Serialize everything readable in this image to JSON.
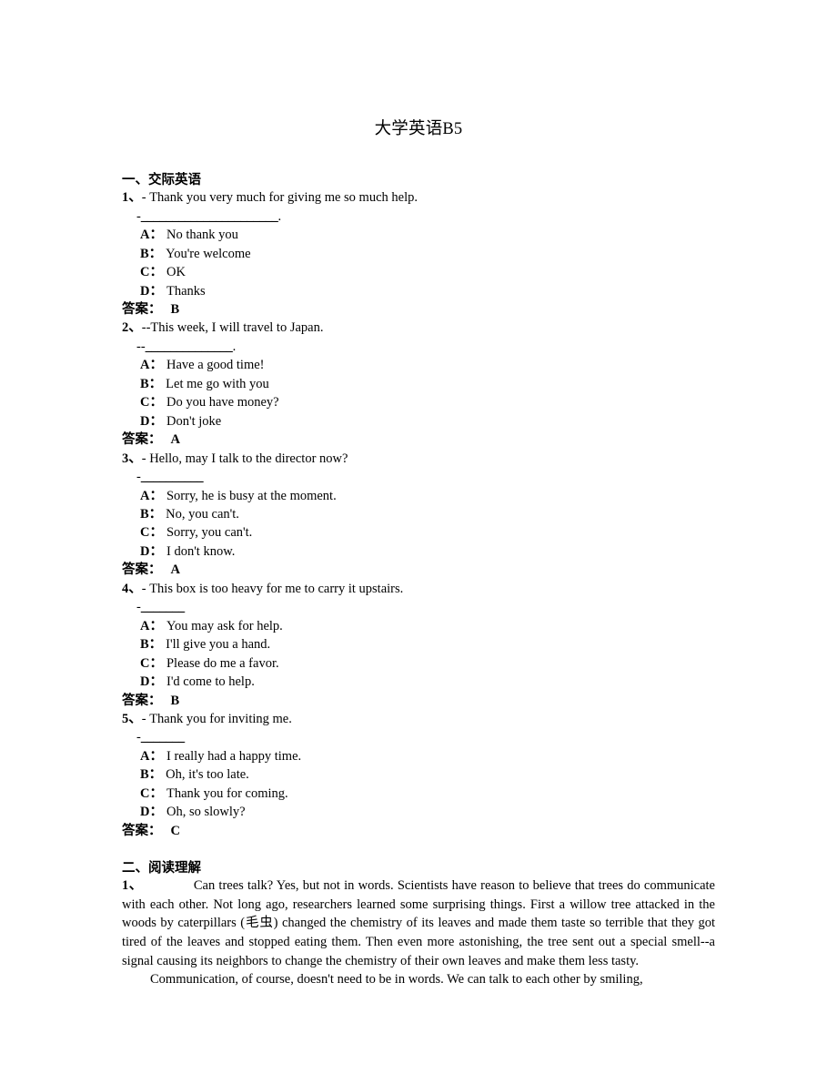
{
  "document": {
    "title": "大学英语B5"
  },
  "sections": [
    {
      "heading": "一、交际英语",
      "questions": [
        {
          "number": "1、",
          "stem": "- Thank you very much for giving me so much help.",
          "blank_prefix": "-",
          "blank": "______________________",
          "blank_suffix": ".",
          "options": [
            {
              "letter": "A：",
              "text": "No thank you"
            },
            {
              "letter": "B：",
              "text": "You're welcome"
            },
            {
              "letter": "C：",
              "text": "OK"
            },
            {
              "letter": "D：",
              "text": "Thanks"
            }
          ],
          "answer_label": "答案：",
          "answer": "B"
        },
        {
          "number": "2、",
          "stem": "--This week, I will travel to Japan.",
          "blank_prefix": "--",
          "blank": "______________",
          "blank_suffix": ".",
          "options": [
            {
              "letter": "A：",
              "text": "Have a good time!"
            },
            {
              "letter": "B：",
              "text": "Let me go with you"
            },
            {
              "letter": "C：",
              "text": "Do you have money?"
            },
            {
              "letter": "D：",
              "text": "Don't joke"
            }
          ],
          "answer_label": "答案：",
          "answer": "A"
        },
        {
          "number": "3、",
          "stem": "- Hello, may I talk to the director now?",
          "blank_prefix": "-",
          "blank": "__________",
          "blank_suffix": "",
          "options": [
            {
              "letter": "A：",
              "text": "Sorry, he is busy at the moment."
            },
            {
              "letter": "B：",
              "text": "No, you can't."
            },
            {
              "letter": "C：",
              "text": "Sorry, you can't."
            },
            {
              "letter": "D：",
              "text": "I don't know."
            }
          ],
          "answer_label": "答案：",
          "answer": "A"
        },
        {
          "number": "4、",
          "stem": "- This box is too heavy for me to carry it upstairs.",
          "blank_prefix": "-",
          "blank": "_______",
          "blank_suffix": "",
          "options": [
            {
              "letter": "A：",
              "text": "You may ask for help."
            },
            {
              "letter": "B：",
              "text": "I'll give you a hand."
            },
            {
              "letter": "C：",
              "text": "Please do me a favor."
            },
            {
              "letter": "D：",
              "text": "I'd come to help."
            }
          ],
          "answer_label": "答案：",
          "answer": "B"
        },
        {
          "number": "5、",
          "stem": "- Thank you for inviting me.",
          "blank_prefix": "-",
          "blank": "_______",
          "blank_suffix": "",
          "options": [
            {
              "letter": "A：",
              "text": "I really had a happy time."
            },
            {
              "letter": "B：",
              "text": "Oh, it's too late."
            },
            {
              "letter": "C：",
              "text": "Thank you for coming."
            },
            {
              "letter": "D：",
              "text": "Oh, so slowly?"
            }
          ],
          "answer_label": "答案：",
          "answer": "C"
        }
      ]
    },
    {
      "heading": "二、阅读理解",
      "reading": {
        "number": "1、",
        "paragraph_1": "Can trees talk? Yes, but not in words. Scientists have reason to believe that trees do communicate with each other. Not long ago, researchers learned some surprising things. First a willow tree attacked in the woods by caterpillars (毛虫) changed the chemistry of its leaves and made them taste so terrible that they got tired of the leaves and stopped eating them. Then even more astonishing, the tree sent out a special smell--a signal causing its neighbors to change the chemistry of their own leaves and make them less tasty.",
        "paragraph_2": "Communication, of course, doesn't need to be in words. We can talk to each other by smiling,"
      }
    }
  ]
}
